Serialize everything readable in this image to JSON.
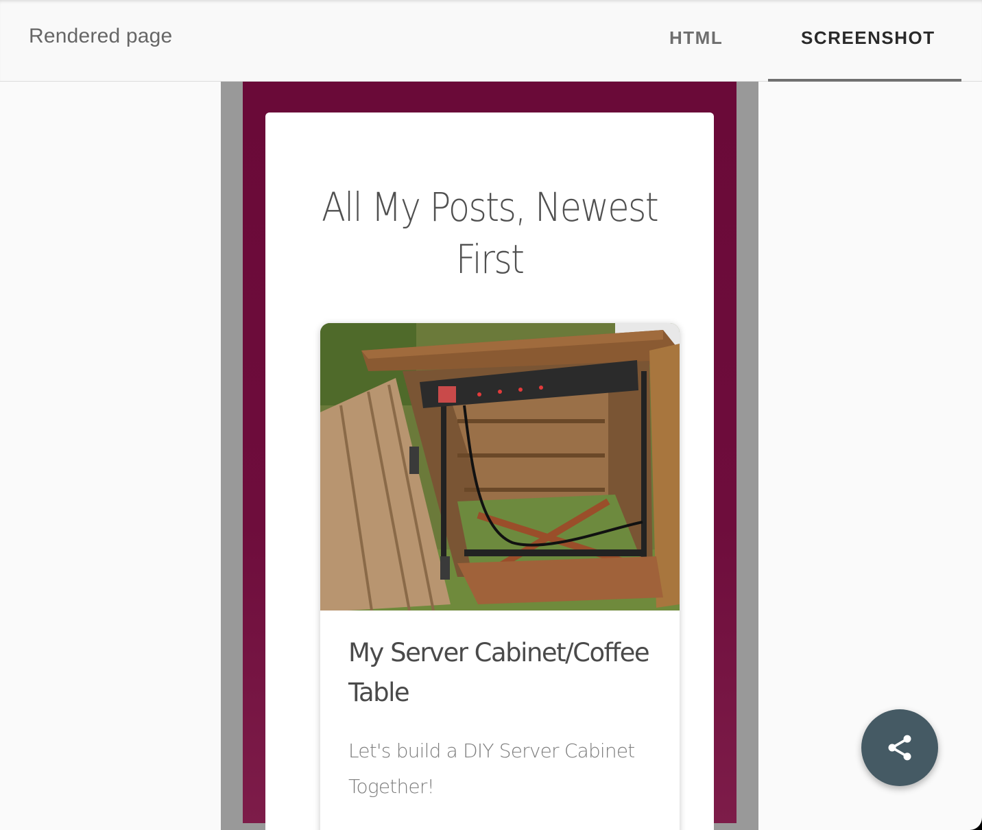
{
  "topbar": {
    "title": "Rendered page",
    "tabs": [
      {
        "label": "HTML",
        "active": false
      },
      {
        "label": "SCREENSHOT",
        "active": true
      }
    ]
  },
  "site": {
    "heading": "All My Posts, Newest First",
    "posts": [
      {
        "title": "My Server Cabinet/Coffee Table",
        "description": "Let's build a DIY Server Cabinet Together!",
        "image": "wooden-server-cabinet-photo"
      }
    ]
  },
  "fab": {
    "icon": "share-icon"
  },
  "colors": {
    "site_background": "#6e0d3c",
    "fab": "#455a64",
    "viewport_frame": "#999999"
  }
}
